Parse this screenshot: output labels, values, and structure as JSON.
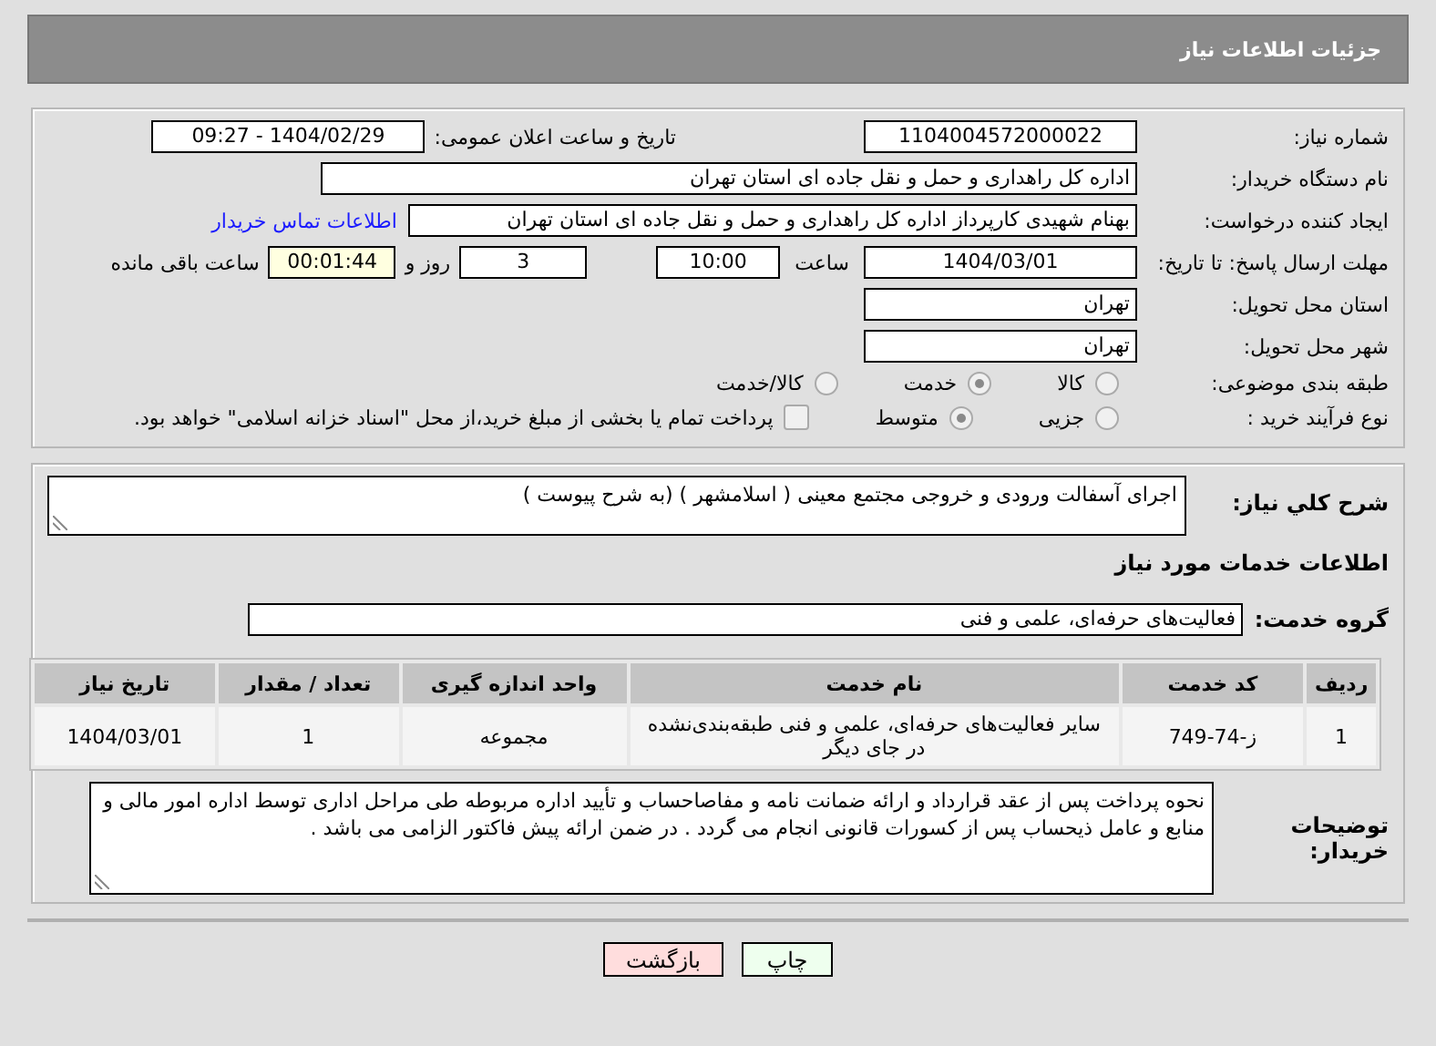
{
  "header": {
    "title": "جزئیات اطلاعات نیاز"
  },
  "details": {
    "need_number": {
      "label": "شماره نیاز:",
      "value": "1104004572000022"
    },
    "announce": {
      "label": "تاریخ و ساعت اعلان عمومی:",
      "value": "1404/02/29 - 09:27"
    },
    "buyer_org": {
      "label": "نام دستگاه خریدار:",
      "value": "اداره کل راهداری و حمل و نقل جاده ای استان تهران"
    },
    "requester": {
      "label": "ایجاد کننده درخواست:",
      "value": "بهنام شهیدی کارپرداز اداره کل راهداری و حمل و نقل جاده ای استان تهران",
      "link": "اطلاعات تماس خریدار"
    },
    "deadline": {
      "label": "مهلت ارسال پاسخ: تا تاریخ:",
      "date": "1404/03/01",
      "time_label": "ساعت",
      "time": "10:00",
      "days": "3",
      "days_label": "روز و",
      "remaining": "00:01:44",
      "remaining_label": "ساعت باقی مانده"
    },
    "province": {
      "label": "استان محل تحویل:",
      "value": "تهران"
    },
    "city": {
      "label": "شهر محل تحویل:",
      "value": "تهران"
    },
    "category": {
      "label": "طبقه بندی موضوعی:",
      "options": [
        {
          "label": "کالا",
          "selected": false
        },
        {
          "label": "خدمت",
          "selected": true
        },
        {
          "label": "کالا/خدمت",
          "selected": false
        }
      ]
    },
    "process": {
      "label": "نوع فرآیند خرید :",
      "options": [
        {
          "label": "جزیی",
          "selected": false
        },
        {
          "label": "متوسط",
          "selected": true
        }
      ],
      "payment": {
        "label": "پرداخت تمام یا بخشی از مبلغ خرید،از محل \"اسناد خزانه اسلامی\" خواهد بود.",
        "checked": false
      }
    }
  },
  "description": {
    "label": "شرح کلي نياز:",
    "value": "اجرای آسفالت ورودی و خروجی مجتمع معینی ( اسلامشهر ) (به شرح پیوست )"
  },
  "services": {
    "heading": "اطلاعات خدمات مورد نیاز",
    "group": {
      "label": "گروه خدمت:",
      "value": "فعالیت‌های حرفه‌ای، علمی و فنی"
    },
    "table": {
      "columns": [
        "ردیف",
        "کد خدمت",
        "نام خدمت",
        "واحد اندازه گیری",
        "تعداد / مقدار",
        "تاریخ نیاز"
      ],
      "rows": [
        [
          "1",
          "ز-74-749",
          "سایر فعالیت‌های حرفه‌ای، علمی و فنی طبقه‌بندی‌نشده در جای دیگر",
          "مجموعه",
          "1",
          "1404/03/01"
        ]
      ]
    }
  },
  "buyer_notes": {
    "label": "توضیحات خریدار:",
    "value": "نحوه پرداخت پس از عقد قرارداد و ارائه ضمانت نامه و مفاصاحساب و تأیید اداره مربوطه طی مراحل اداری توسط اداره امور مالی و منابع و عامل ذیحساب پس از کسورات قانونی انجام می گردد . در ضمن ارائه پیش فاکتور الزامی می باشد ."
  },
  "buttons": [
    {
      "label": "چاپ",
      "kind": "print"
    },
    {
      "label": "بازگشت",
      "kind": "back"
    }
  ]
}
